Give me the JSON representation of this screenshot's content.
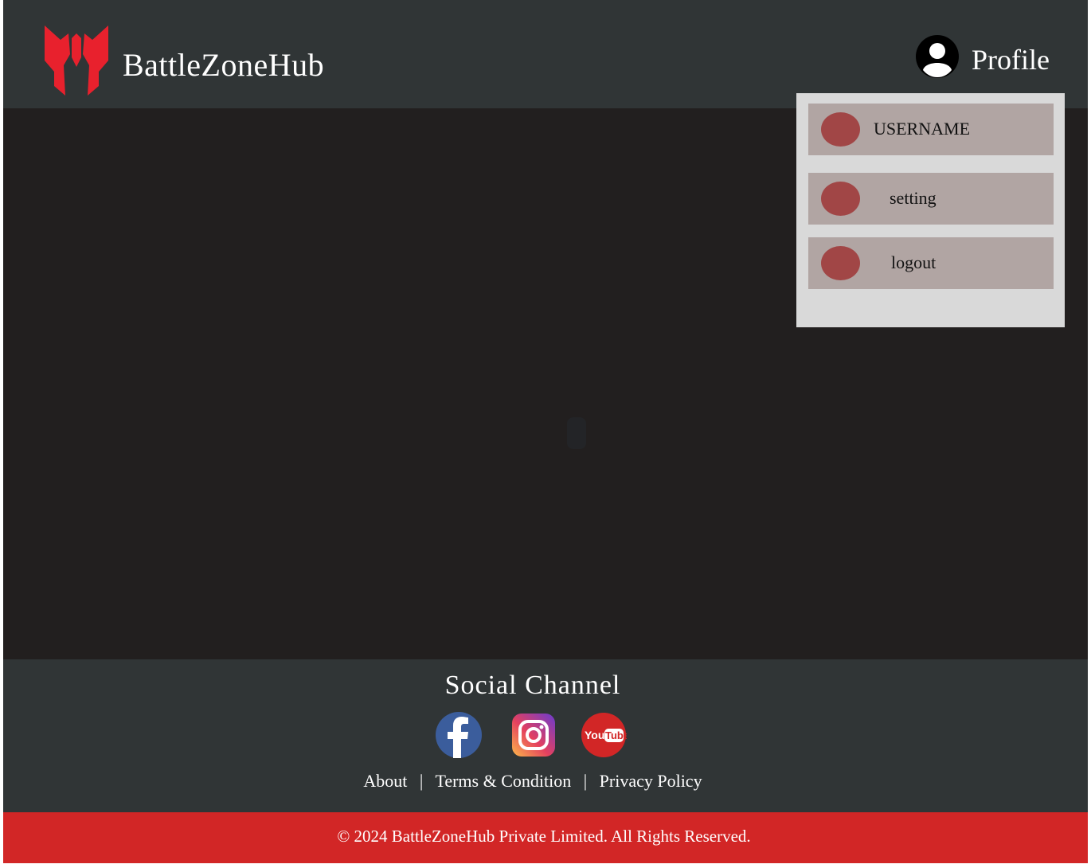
{
  "header": {
    "brand": "BattleZoneHub",
    "profile_label": "Profile"
  },
  "dropdown": {
    "items": [
      {
        "label": "USERNAME"
      },
      {
        "label": "setting"
      },
      {
        "label": "logout"
      }
    ]
  },
  "footer": {
    "title": "Social Channel",
    "social": [
      "facebook-icon",
      "instagram-icon",
      "youtube-icon"
    ],
    "links": [
      "About",
      "Terms & Condition",
      "Privacy Policy"
    ],
    "separator": "|",
    "copyright": "© 2024 BattleZoneHub Private Limited. All Rights Reserved."
  },
  "colors": {
    "header_bg": "#303536",
    "main_bg": "#221f1f",
    "accent_red": "#d22626",
    "logo_red": "#e8212d",
    "menu_bg": "#d9d9d9",
    "menu_item_bg": "#b1a5a3",
    "menu_dot": "#a14646"
  }
}
